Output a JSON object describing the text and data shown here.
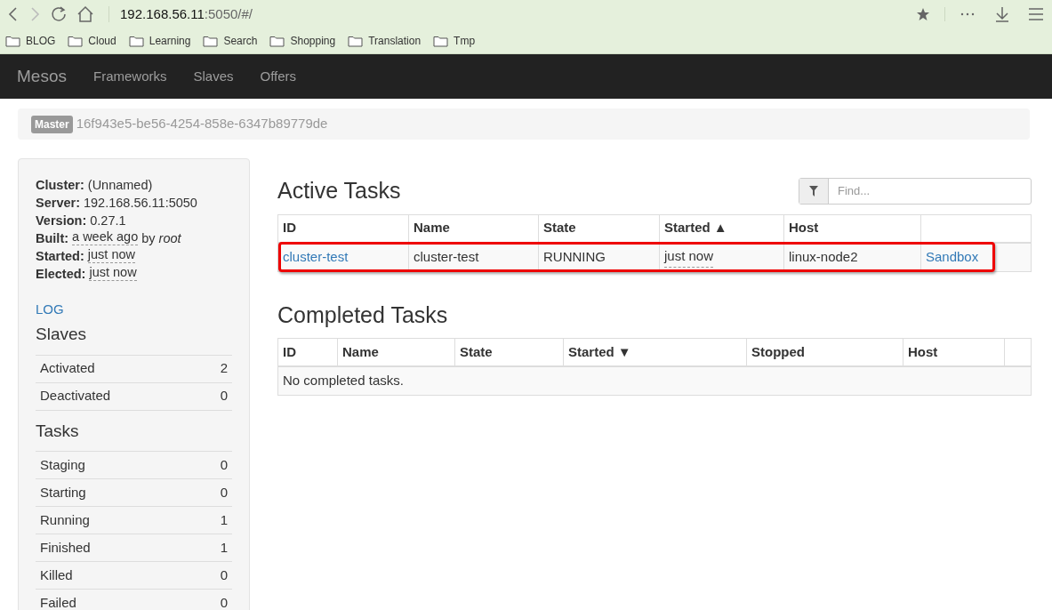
{
  "browser": {
    "url_host": "192.168.56.11",
    "url_rest": ":5050/#/",
    "bookmarks": [
      "BLOG",
      "Cloud",
      "Learning",
      "Search",
      "Shopping",
      "Translation",
      "Tmp"
    ]
  },
  "navbar": {
    "brand": "Mesos",
    "links": [
      "Frameworks",
      "Slaves",
      "Offers"
    ]
  },
  "master": {
    "badge": "Master",
    "id": "16f943e5-be56-4254-858e-6347b89779de"
  },
  "cluster_info": [
    {
      "label": "Cluster:",
      "value": "(Unnamed)",
      "kind": "plain"
    },
    {
      "label": "Server:",
      "value": "192.168.56.11:5050",
      "kind": "plain"
    },
    {
      "label": "Version:",
      "value": "0.27.1",
      "kind": "plain"
    },
    {
      "label": "Built:",
      "value": "a week ago",
      "kind": "time",
      "suffix": "by *root*"
    },
    {
      "label": "Started:",
      "value": "just now",
      "kind": "time"
    },
    {
      "label": "Elected:",
      "value": "just now",
      "kind": "time"
    }
  ],
  "log_link": "LOG",
  "slaves": {
    "title": "Slaves",
    "rows": [
      {
        "label": "Activated",
        "count": "2"
      },
      {
        "label": "Deactivated",
        "count": "0"
      }
    ]
  },
  "tasks": {
    "title": "Tasks",
    "rows": [
      {
        "label": "Staging",
        "count": "0"
      },
      {
        "label": "Starting",
        "count": "0"
      },
      {
        "label": "Running",
        "count": "1"
      },
      {
        "label": "Finished",
        "count": "1"
      },
      {
        "label": "Killed",
        "count": "0"
      },
      {
        "label": "Failed",
        "count": "0"
      }
    ]
  },
  "active_tasks": {
    "title": "Active Tasks",
    "filter": {
      "placeholder": "Find..."
    },
    "columns": [
      {
        "label": "ID"
      },
      {
        "label": "Name"
      },
      {
        "label": "State"
      },
      {
        "label": "Started",
        "sort": "▲"
      },
      {
        "label": "Host"
      },
      {}
    ],
    "rows": [
      {
        "highlighted": true,
        "cells": [
          {
            "text": "cluster-test",
            "kind": "link"
          },
          {
            "text": "cluster-test",
            "kind": "plain"
          },
          {
            "text": "RUNNING",
            "kind": "plain"
          },
          {
            "text": "just now",
            "kind": "time"
          },
          {
            "text": "linux-node2",
            "kind": "plain"
          },
          {
            "text": "Sandbox",
            "kind": "link"
          }
        ]
      }
    ]
  },
  "completed_tasks": {
    "title": "Completed Tasks",
    "columns": [
      {
        "label": "ID"
      },
      {
        "label": "Name"
      },
      {
        "label": "State"
      },
      {
        "label": "Started",
        "sort": "▼"
      },
      {
        "label": "Stopped"
      },
      {
        "label": "Host"
      },
      {}
    ],
    "empty_message": "No completed tasks."
  }
}
